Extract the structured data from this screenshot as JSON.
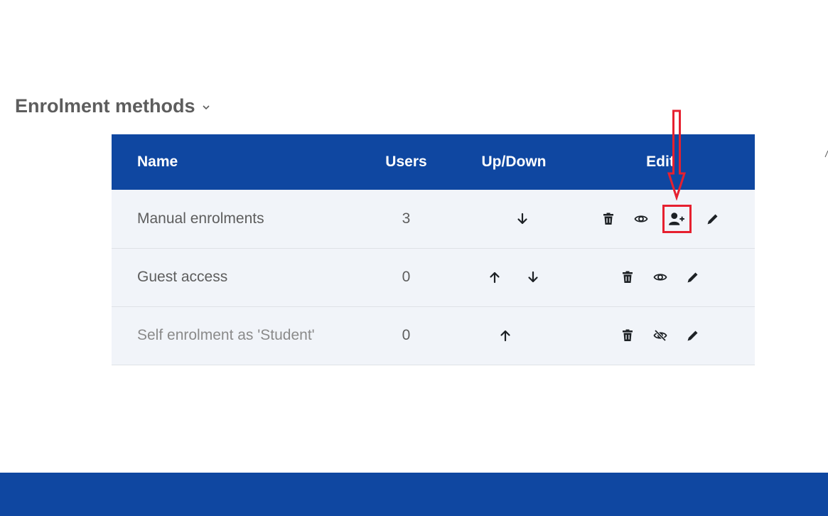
{
  "section": {
    "title": "Enrolment methods"
  },
  "table": {
    "headers": {
      "name": "Name",
      "users": "Users",
      "updown": "Up/Down",
      "edit": "Edit"
    },
    "rows": [
      {
        "name": "Manual enrolments",
        "users": "3",
        "up": false,
        "down": true,
        "actions": [
          "delete-icon",
          "eye-icon",
          "enrol-users-icon",
          "pencil-icon"
        ],
        "enabled": true
      },
      {
        "name": "Guest access",
        "users": "0",
        "up": true,
        "down": true,
        "actions": [
          "delete-icon",
          "eye-icon",
          "pencil-icon"
        ],
        "enabled": true
      },
      {
        "name": "Self enrolment as 'Student'",
        "users": "0",
        "up": true,
        "down": false,
        "actions": [
          "delete-icon",
          "eye-slash-icon",
          "pencil-icon"
        ],
        "enabled": false
      }
    ]
  },
  "annotation": {
    "highlight_color": "#e6202f",
    "highlighted_action": "enrol-users-icon"
  },
  "colors": {
    "header_bg": "#0f47a1",
    "row_bg": "#f1f4f9",
    "footer_bg": "#0f47a1"
  }
}
